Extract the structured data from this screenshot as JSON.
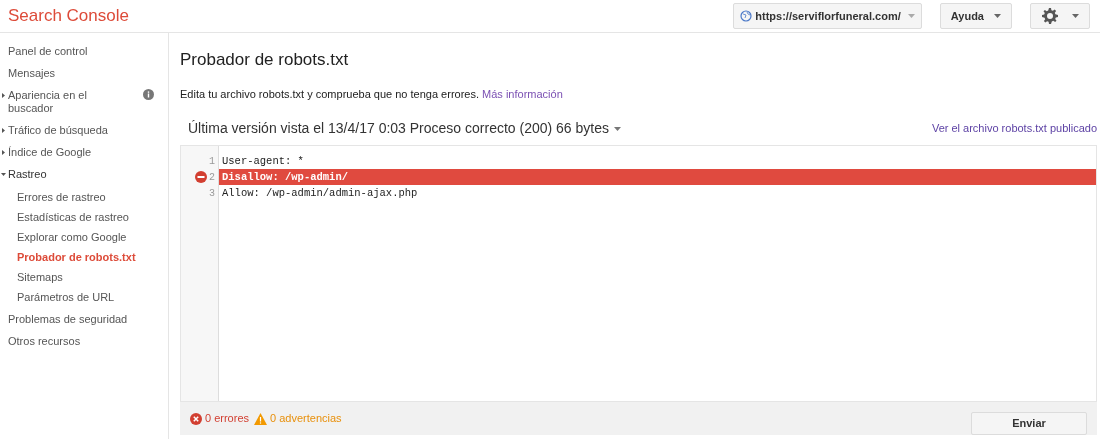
{
  "header": {
    "logo": "Search Console",
    "site": "https://serviflorfuneral.com/",
    "help": "Ayuda"
  },
  "sidebar": {
    "items": [
      {
        "label": "Panel de control",
        "selected": false
      },
      {
        "label": "Mensajes",
        "selected": false
      },
      {
        "label": "Apariencia en el buscador",
        "selected": false,
        "expanded": false,
        "info": true
      },
      {
        "label": "Tráfico de búsqueda",
        "selected": false,
        "expanded": false
      },
      {
        "label": "Índice de Google",
        "selected": false,
        "expanded": false
      },
      {
        "label": "Rastreo",
        "selected": false,
        "expanded": true,
        "children": [
          {
            "label": "Errores de rastreo",
            "selected": false
          },
          {
            "label": "Estadísticas de rastreo",
            "selected": false
          },
          {
            "label": "Explorar como Google",
            "selected": false
          },
          {
            "label": "Probador de robots.txt",
            "selected": true
          },
          {
            "label": "Sitemaps",
            "selected": false
          },
          {
            "label": "Parámetros de URL",
            "selected": false
          }
        ]
      },
      {
        "label": "Problemas de seguridad",
        "selected": false
      },
      {
        "label": "Otros recursos",
        "selected": false
      }
    ]
  },
  "page": {
    "title": "Probador de robots.txt",
    "description": "Edita tu archivo robots.txt y comprueba que no tenga errores.",
    "more_link": "Más información",
    "version": "Última versión vista el 13/4/17 0:03 Proceso correcto (200) 66 bytes",
    "view_link": "Ver el archivo robots.txt publicado"
  },
  "editor": {
    "lines": [
      {
        "number": "1",
        "text": "User-agent: *",
        "error": false
      },
      {
        "number": "2",
        "text": "Disallow: /wp-admin/",
        "error": true
      },
      {
        "number": "3",
        "text": "Allow: /wp-admin/admin-ajax.php",
        "error": false
      }
    ]
  },
  "footer": {
    "errors": "0 errores",
    "warnings": "0 advertencias",
    "submit": "Enviar"
  }
}
